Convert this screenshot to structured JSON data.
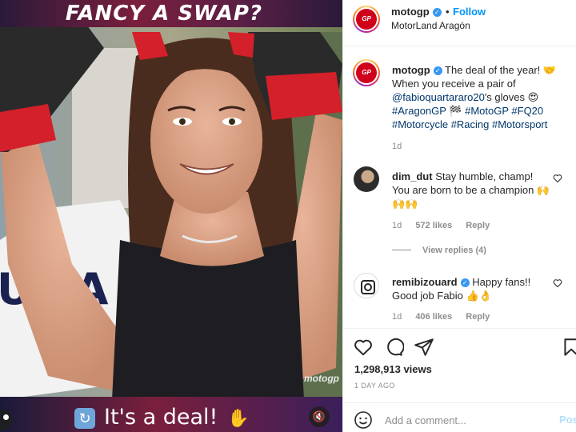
{
  "media": {
    "banner_title": "FANCY A SWAP?",
    "deal_text": "It's a deal!",
    "watermark": "motogp"
  },
  "post": {
    "username": "motogp",
    "follow_label": "Follow",
    "location": "MotorLand Aragón",
    "caption_text": "The deal of the year! 🤝 When you receive a pair of ",
    "caption_mention": "@fabioquartararo20",
    "caption_rest": "'s gloves 😍 ",
    "caption_hashtags": "#AragonGP 🏁 #MotoGP #FQ20 #Motorcycle #Racing #Motorsport",
    "caption_time": "1d",
    "views": "1,298,913 views",
    "date": "1 DAY AGO"
  },
  "comments": [
    {
      "username": "dim_dut",
      "text": "Stay humble, champ! You are born to be a champion 🙌🙌🙌",
      "time": "1d",
      "likes": "572 likes",
      "reply_label": "Reply",
      "view_replies": "View replies (4)"
    },
    {
      "username": "remibizouard",
      "text": "Happy fans!! Good job Fabio 👍👌",
      "time": "1d",
      "likes": "406 likes",
      "reply_label": "Reply"
    }
  ],
  "add_comment": {
    "placeholder": "Add a comment...",
    "post_label": "Post"
  },
  "icons": {
    "like": "heart-icon",
    "comment": "comment-icon",
    "share": "paper-plane-icon",
    "save": "bookmark-icon",
    "emoji": "smiley-icon",
    "mute": "speaker-muted-icon",
    "user_tag": "user-tag-icon"
  },
  "colors": {
    "link": "#00376b",
    "follow": "#0095f6",
    "verified": "#3897f0",
    "muted_text": "#8e8e8e"
  }
}
